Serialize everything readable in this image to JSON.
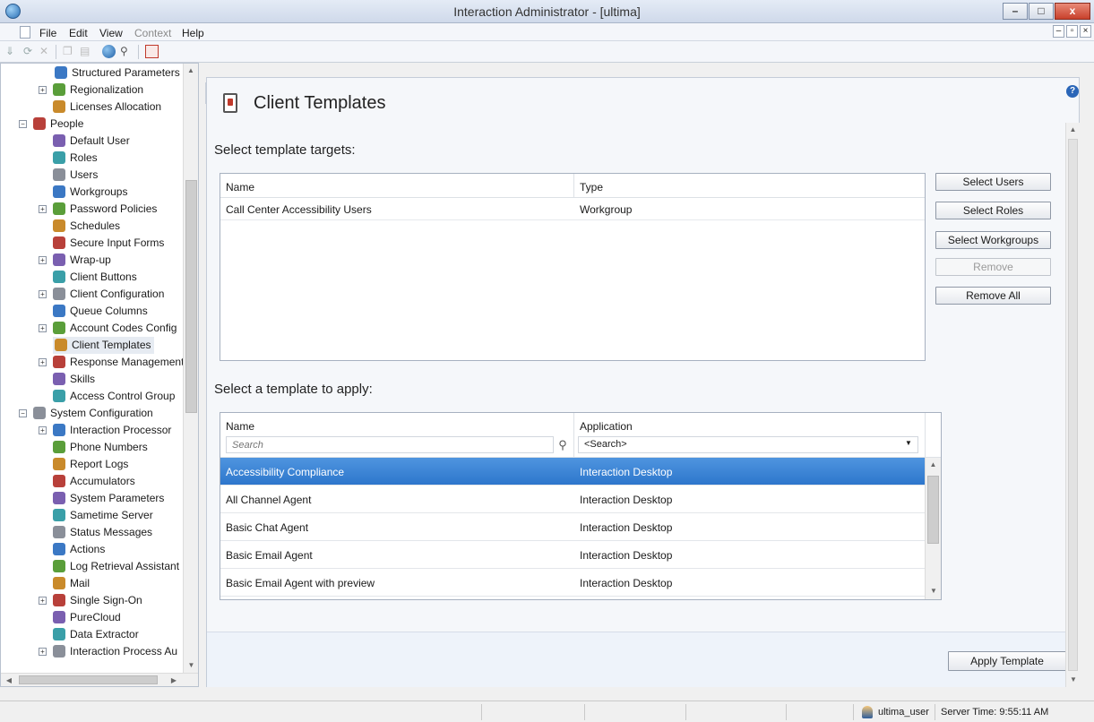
{
  "window": {
    "title": "Interaction Administrator - [ultima]",
    "minimize": "–",
    "maximize": "□",
    "close": "x"
  },
  "menu": {
    "items": [
      "File",
      "Edit",
      "View",
      "Context",
      "Help"
    ]
  },
  "tree": {
    "items": [
      {
        "label": "Structured Parameters",
        "level": 2,
        "icon": "structured-parameters-icon"
      },
      {
        "label": "Regionalization",
        "level": 1,
        "icon": "globe-icon",
        "expander": "+"
      },
      {
        "label": "Licenses Allocation",
        "level": 1,
        "icon": "license-icon"
      },
      {
        "label": "People",
        "level": 0,
        "icon": "people-icon",
        "expander": "−"
      },
      {
        "label": "Default User",
        "level": 1,
        "icon": "default-user-icon"
      },
      {
        "label": "Roles",
        "level": 1,
        "icon": "roles-icon"
      },
      {
        "label": "Users",
        "level": 1,
        "icon": "users-icon"
      },
      {
        "label": "Workgroups",
        "level": 1,
        "icon": "workgroups-icon"
      },
      {
        "label": "Password Policies",
        "level": 1,
        "icon": "key-icon",
        "expander": "+"
      },
      {
        "label": "Schedules",
        "level": 1,
        "icon": "schedules-icon"
      },
      {
        "label": "Secure Input Forms",
        "level": 1,
        "icon": "secure-forms-icon"
      },
      {
        "label": "Wrap-up",
        "level": 1,
        "icon": "wrapup-icon",
        "expander": "+"
      },
      {
        "label": "Client Buttons",
        "level": 1,
        "icon": "client-buttons-icon"
      },
      {
        "label": "Client Configuration",
        "level": 1,
        "icon": "client-config-icon",
        "expander": "+"
      },
      {
        "label": "Queue Columns",
        "level": 1,
        "icon": "queue-columns-icon"
      },
      {
        "label": "Account Codes Config",
        "level": 1,
        "icon": "account-codes-icon",
        "expander": "+"
      },
      {
        "label": "Client Templates",
        "level": 1,
        "icon": "client-templates-icon",
        "selected": true
      },
      {
        "label": "Response Management",
        "level": 1,
        "icon": "response-icon",
        "expander": "+"
      },
      {
        "label": "Skills",
        "level": 1,
        "icon": "skills-icon"
      },
      {
        "label": "Access Control Group",
        "level": 1,
        "icon": "access-control-icon"
      },
      {
        "label": "System Configuration",
        "level": 0,
        "icon": "system-config-icon",
        "expander": "−"
      },
      {
        "label": "Interaction Processor",
        "level": 1,
        "icon": "processor-icon",
        "expander": "+"
      },
      {
        "label": "Phone Numbers",
        "level": 1,
        "icon": "phone-icon"
      },
      {
        "label": "Report Logs",
        "level": 1,
        "icon": "folder-icon"
      },
      {
        "label": "Accumulators",
        "level": 1,
        "icon": "accumulator-icon"
      },
      {
        "label": "System Parameters",
        "level": 1,
        "icon": "system-params-icon"
      },
      {
        "label": "Sametime Server",
        "level": 1,
        "icon": "server-icon"
      },
      {
        "label": "Status Messages",
        "level": 1,
        "icon": "status-icon"
      },
      {
        "label": "Actions",
        "level": 1,
        "icon": "actions-icon"
      },
      {
        "label": "Log Retrieval Assistant",
        "level": 1,
        "icon": "log-icon"
      },
      {
        "label": "Mail",
        "level": 1,
        "icon": "mail-icon"
      },
      {
        "label": "Single Sign-On",
        "level": 1,
        "icon": "sso-icon",
        "expander": "+"
      },
      {
        "label": "PureCloud",
        "level": 1,
        "icon": "purecloud-icon"
      },
      {
        "label": "Data Extractor",
        "level": 1,
        "icon": "data-extractor-icon"
      },
      {
        "label": "Interaction Process Au",
        "level": 1,
        "icon": "process-icon",
        "expander": "+"
      }
    ]
  },
  "page": {
    "title": "Client Templates",
    "help": "?"
  },
  "targets": {
    "heading": "Select template targets:",
    "columns": [
      "Name",
      "Type"
    ],
    "rows": [
      {
        "name": "Call Center Accessibility Users",
        "type": "Workgroup"
      }
    ],
    "buttons": {
      "select_users": "Select Users",
      "select_roles": "Select Roles",
      "select_workgroups": "Select Workgroups",
      "remove": "Remove",
      "remove_all": "Remove All"
    }
  },
  "templates": {
    "heading": "Select a template to apply:",
    "columns": [
      "Name",
      "Application"
    ],
    "name_search_placeholder": "Search",
    "application_filter": "<Search>",
    "rows": [
      {
        "name": "Accessibility Compliance",
        "application": "Interaction Desktop",
        "selected": true
      },
      {
        "name": "All Channel Agent",
        "application": "Interaction Desktop"
      },
      {
        "name": "Basic Chat Agent",
        "application": "Interaction Desktop"
      },
      {
        "name": "Basic Email Agent",
        "application": "Interaction Desktop"
      },
      {
        "name": "Basic Email Agent with preview",
        "application": "Interaction Desktop"
      }
    ],
    "apply_label": "Apply Template"
  },
  "status": {
    "user": "ultima_user",
    "server_time": "Server Time: 9:55:11 AM"
  },
  "scroll": {
    "tree_position": 0.4,
    "templates_position": 0.2
  },
  "colors": {
    "selection": "#3a83d6",
    "window_bg": "#f0f0f0"
  }
}
